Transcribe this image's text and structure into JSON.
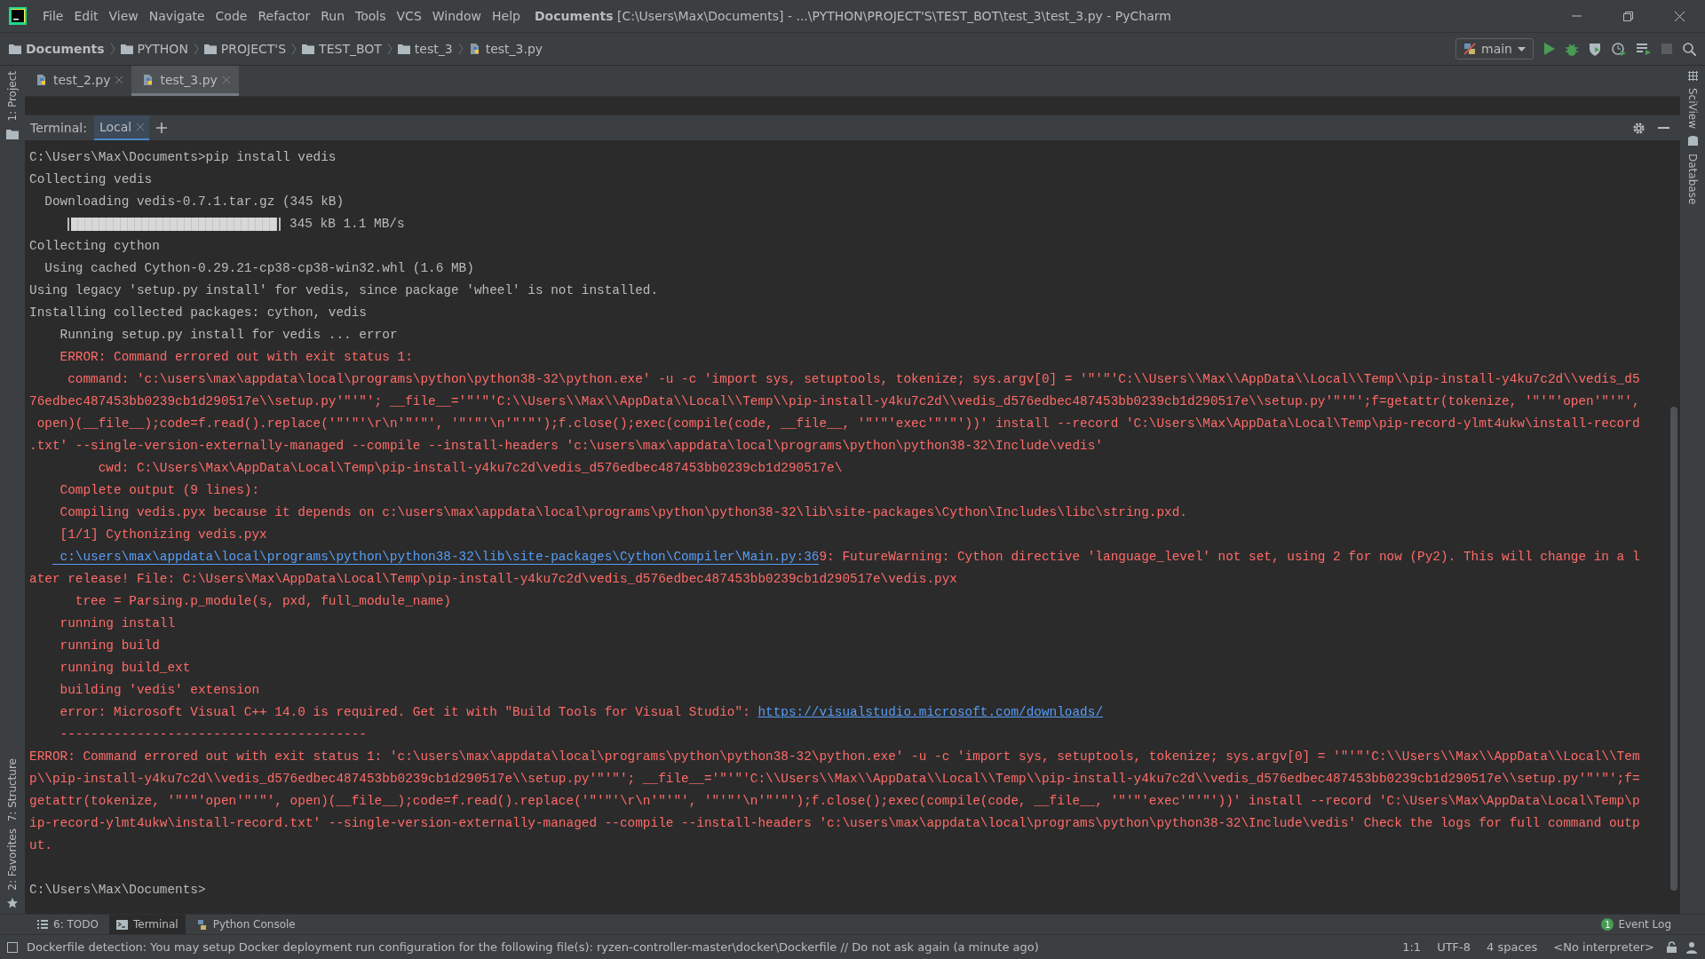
{
  "menu_bar": {
    "items": [
      "File",
      "Edit",
      "View",
      "Navigate",
      "Code",
      "Refactor",
      "Run",
      "Tools",
      "VCS",
      "Window",
      "Help"
    ],
    "title": "**Documents** [C:\\Users\\Max\\Documents] - ...\\PYTHON\\PROJECT'S\\TEST_BOT\\test_3\\test_3.py - PyCharm"
  },
  "breadcrumbs": [
    {
      "label": "Documents",
      "kind": "root"
    },
    {
      "label": "PYTHON",
      "kind": "folder"
    },
    {
      "label": "PROJECT'S",
      "kind": "folder"
    },
    {
      "label": "TEST_BOT",
      "kind": "folder"
    },
    {
      "label": "test_3",
      "kind": "folder"
    },
    {
      "label": "test_3.py",
      "kind": "file"
    }
  ],
  "run_config": {
    "label": "main"
  },
  "editor_tabs": [
    {
      "label": "test_2.py",
      "selected": false
    },
    {
      "label": "test_3.py",
      "selected": true
    }
  ],
  "left_strip": {
    "top": [
      "1: Project"
    ],
    "bottom": [
      "7: Structure",
      "2: Favorites"
    ]
  },
  "right_strip": [
    "SciView",
    "Database"
  ],
  "terminal": {
    "label": "Terminal:",
    "tabs": [
      {
        "label": "Local",
        "selected": true
      }
    ],
    "lines": [
      {
        "kind": "text",
        "error": false,
        "text": "C:\\Users\\Max\\Documents>pip install vedis"
      },
      {
        "kind": "text",
        "error": false,
        "text": "Collecting vedis"
      },
      {
        "kind": "text",
        "error": false,
        "text": "  Downloading vedis-0.7.1.tar.gz (345 kB)"
      },
      {
        "kind": "progress",
        "error": false,
        "level": 1,
        "reading": "345 kB 1.1 MB/s"
      },
      {
        "kind": "text",
        "error": false,
        "text": "Collecting cython"
      },
      {
        "kind": "text",
        "error": false,
        "text": "  Using cached Cython-0.29.21-cp38-cp38-win32.whl (1.6 MB)"
      },
      {
        "kind": "text",
        "error": false,
        "text": "Using legacy 'setup.py install' for vedis, since package 'wheel' is not installed."
      },
      {
        "kind": "text",
        "error": false,
        "text": "Installing collected packages: cython, vedis"
      },
      {
        "kind": "text",
        "error": false,
        "text": "    Running setup.py install for vedis ... error"
      },
      {
        "kind": "text",
        "error": true,
        "text": "    ERROR: Command errored out with exit status 1:"
      },
      {
        "kind": "text",
        "error": true,
        "text": "     command: 'c:\\users\\max\\appdata\\local\\programs\\python\\python38-32\\python.exe' -u -c 'import sys, setuptools, tokenize; sys.argv[0] = '\"'\"'C:\\\\Users\\\\Max\\\\AppData\\\\Local\\\\Temp\\\\pip-install-y4ku7c2d\\\\vedis_d5"
      },
      {
        "kind": "text",
        "error": true,
        "text": "76edbec487453bb0239cb1d290517e\\\\setup.py'\"'\"'; __file__='\"'\"'C:\\\\Users\\\\Max\\\\AppData\\\\Local\\\\Temp\\\\pip-install-y4ku7c2d\\\\vedis_d576edbec487453bb0239cb1d290517e\\\\setup.py'\"'\"';f=getattr(tokenize, '\"'\"'open'\"'\"',"
      },
      {
        "kind": "text",
        "error": true,
        "text": " open)(__file__);code=f.read().replace('\"'\"'\\r\\n'\"'\"', '\"'\"'\\n'\"'\"');f.close();exec(compile(code, __file__, '\"'\"'exec'\"'\"'))' install --record 'C:\\Users\\Max\\AppData\\Local\\Temp\\pip-record-ylmt4ukw\\install-record"
      },
      {
        "kind": "text",
        "error": true,
        "text": ".txt' --single-version-externally-managed --compile --install-headers 'c:\\users\\max\\appdata\\local\\programs\\python\\python38-32\\Include\\vedis'"
      },
      {
        "kind": "text",
        "error": true,
        "text": "         cwd: C:\\Users\\Max\\AppData\\Local\\Temp\\pip-install-y4ku7c2d\\vedis_d576edbec487453bb0239cb1d290517e\\"
      },
      {
        "kind": "text",
        "error": true,
        "text": "    Complete output (9 lines):"
      },
      {
        "kind": "text",
        "error": true,
        "text": "    Compiling vedis.pyx because it depends on c:\\users\\max\\appdata\\local\\programs\\python\\python38-32\\lib\\site-packages\\Cython\\Includes\\libc\\string.pxd."
      },
      {
        "kind": "text",
        "error": true,
        "text": "    [1/1] Cythonizing vedis.pyx"
      },
      {
        "kind": "link",
        "error": true,
        "link": "c:\\users\\max\\appdata\\local\\programs\\python\\python38-32\\lib\\site-packages\\Cython\\Compiler\\Main.py:36",
        "rest": "9: FutureWarning: Cython directive 'language_level' not set, using 2 for now (Py2). This will change in a l"
      },
      {
        "kind": "text",
        "error": true,
        "text": "ater release! File: C:\\Users\\Max\\AppData\\Local\\Temp\\pip-install-y4ku7c2d\\vedis_d576edbec487453bb0239cb1d290517e\\vedis.pyx"
      },
      {
        "kind": "text",
        "error": true,
        "text": "      tree = Parsing.p_module(s, pxd, full_module_name)"
      },
      {
        "kind": "text",
        "error": true,
        "text": "    running install"
      },
      {
        "kind": "text",
        "error": true,
        "text": "    running build"
      },
      {
        "kind": "text",
        "error": true,
        "text": "    running build_ext"
      },
      {
        "kind": "text",
        "error": true,
        "text": "    building 'vedis' extension"
      },
      {
        "kind": "link",
        "error": true,
        "text": "    error: Microsoft Visual C++ 14.0 is required. Get it with \"Build Tools for Visual Studio\": ",
        "link": "https://visualstudio.microsoft.com/downloads/"
      },
      {
        "kind": "text",
        "error": true,
        "text": "    ----------------------------------------"
      },
      {
        "kind": "text",
        "error": true,
        "text": "ERROR: Command errored out with exit status 1: 'c:\\users\\max\\appdata\\local\\programs\\python\\python38-32\\python.exe' -u -c 'import sys, setuptools, tokenize; sys.argv[0] = '\"'\"'C:\\\\Users\\\\Max\\\\AppData\\\\Local\\\\Tem"
      },
      {
        "kind": "text",
        "error": true,
        "text": "p\\\\pip-install-y4ku7c2d\\\\vedis_d576edbec487453bb0239cb1d290517e\\\\setup.py'\"'\"'; __file__='\"'\"'C:\\\\Users\\\\Max\\\\AppData\\\\Local\\\\Temp\\\\pip-install-y4ku7c2d\\\\vedis_d576edbec487453bb0239cb1d290517e\\\\setup.py'\"'\"';f="
      },
      {
        "kind": "text",
        "error": true,
        "text": "getattr(tokenize, '\"'\"'open'\"'\"', open)(__file__);code=f.read().replace('\"'\"'\\r\\n'\"'\"', '\"'\"'\\n'\"'\"');f.close();exec(compile(code, __file__, '\"'\"'exec'\"'\"'))' install --record 'C:\\Users\\Max\\AppData\\Local\\Temp\\p"
      },
      {
        "kind": "text",
        "error": true,
        "text": "ip-record-ylmt4ukw\\install-record.txt' --single-version-externally-managed --compile --install-headers 'c:\\users\\max\\appdata\\local\\programs\\python\\python38-32\\Include\\vedis' Check the logs for full command outp"
      },
      {
        "kind": "text",
        "error": true,
        "text": "ut."
      }
    ],
    "prompt": "C:\\Users\\Max\\Documents>"
  },
  "tool_tabs": [
    {
      "label": "6: TODO",
      "kind": "todo",
      "selected": false
    },
    {
      "label": "Terminal",
      "kind": "terminal",
      "selected": true
    },
    {
      "label": "Python Console",
      "kind": "console",
      "selected": false
    }
  ],
  "event_log": {
    "label": "Event Log",
    "count": "1"
  },
  "status_bar": {
    "message": "Dockerfile detection: You may setup Docker deployment run configuration for the following file(s): ryzen-controller-master\\docker\\Dockerfile // Do not ask again (a minute ago)",
    "items": [
      "1:1",
      "UTF-8",
      "4 spaces",
      "<No interpreter>"
    ]
  }
}
